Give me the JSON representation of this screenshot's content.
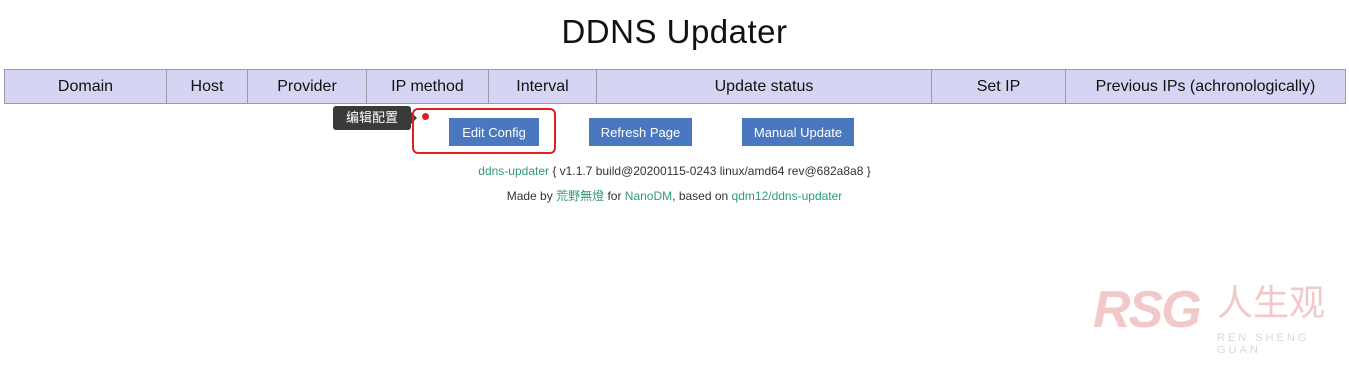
{
  "title": "DDNS Updater",
  "table": {
    "headers": [
      "Domain",
      "Host",
      "Provider",
      "IP method",
      "Interval",
      "Update status",
      "Set IP",
      "Previous IPs (achronologically)"
    ]
  },
  "buttons": {
    "edit_config": "Edit Config",
    "refresh_page": "Refresh Page",
    "manual_update": "Manual Update"
  },
  "tooltip": "编辑配置",
  "footer": {
    "app_link": "ddns-updater",
    "version_text": "{ v1.1.7 build@20200115-0243 linux/amd64 rev@682a8a8 }",
    "made_by": "Made by",
    "author_link": "荒野無燈",
    "for_text": "for",
    "nanodm_link": "NanoDM",
    "based_on": ", based on",
    "upstream_link": "qdm12/ddns-updater"
  },
  "watermark": {
    "logo": "RSG",
    "chinese": "人生观",
    "english": "REN SHENG GUAN"
  },
  "colors": {
    "table_header_bg": "#d5d5f3",
    "button_bg": "#4a78c0",
    "link": "#2f9a7e",
    "highlight": "#e02020"
  }
}
